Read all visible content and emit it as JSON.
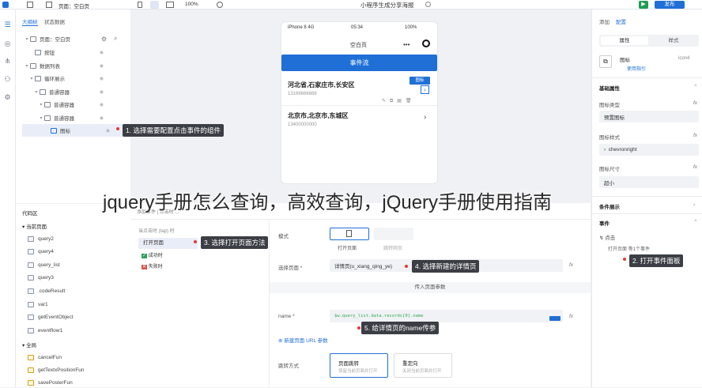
{
  "topbar": {
    "page_label": "页面：空白页",
    "zoom": "100%",
    "title": "小程序生成分享海报",
    "run_label": "",
    "publish_label": "发布"
  },
  "left": {
    "tabs": [
      "大纲树",
      "状态数据"
    ],
    "tree": [
      {
        "label": "页面：空白页",
        "indent": 0
      },
      {
        "label": "按钮",
        "indent": 1
      },
      {
        "label": "数据列表",
        "indent": 1
      },
      {
        "label": "循环展示",
        "indent": 2
      },
      {
        "label": "普通容器",
        "indent": 3
      },
      {
        "label": "普通容器",
        "indent": 4
      },
      {
        "label": "普通容器",
        "indent": 4
      },
      {
        "label": "图标",
        "indent": 5
      }
    ],
    "code_title": "代码区",
    "code_groups": [
      {
        "title": "当前页面",
        "items": [
          "query2",
          "query4",
          "query_list",
          "query3",
          ".codeResult",
          "var1",
          "getEventObject",
          "eventflow1"
        ]
      },
      {
        "title": "全局",
        "items": [
          "cancelFun",
          "getTextxPositionFun",
          "savePosterFun"
        ]
      }
    ]
  },
  "phone": {
    "status_left": "iPhone 8  4G",
    "time": "05:34",
    "battery": "100%",
    "page_title": "空白页",
    "button": "事件流",
    "addr1": "河北省,石家庄市,长安区",
    "phone1": "13166666666",
    "addr2": "北京市,北京市,东城区",
    "phone2": "13400000000",
    "chip": "图标"
  },
  "event": {
    "header": "添加事件 | 点击时 ...",
    "subheader": "当点击时 (tap) 时",
    "actions": [
      "打开页面",
      "成功时",
      "失败时"
    ],
    "mode_label": "模式",
    "mode_options": [
      "打开页面",
      "跳转网页"
    ],
    "select_label": "选择页面 *",
    "select_value": "详情页(u_xiang_qing_ye)",
    "params_title": "传入页面参数",
    "name_label": "name *",
    "name_value": "$w.query_list.data.records[0].name",
    "add_param": "新建页面 URL 参数",
    "jump_label": "跳转方式",
    "jump_opt1": "页面跳转",
    "jump_opt1_sub": "保留当前页面并打开",
    "jump_opt2": "重定向",
    "jump_opt2_sub": "关闭当前页面并打开"
  },
  "right": {
    "tabs": [
      "添加",
      "配置"
    ],
    "subtabs": [
      "属性",
      "样式"
    ],
    "component_name": "图标",
    "component_link": "使用指引",
    "component_id": "icon4",
    "basic": "基础属性",
    "icon_type_label": "图标类型",
    "icon_type_value": "预置图标",
    "icon_style_label": "图标样式",
    "icon_style_value": "chevronright",
    "icon_size_label": "图标尺寸",
    "icon_size_value": "超小",
    "cond": "条件展示",
    "events": "事件",
    "event_item": "点击",
    "event_sub": "打开页面 等1个事件"
  },
  "callouts": [
    "1. 选择需要配置点击事件的组件",
    "2. 打开事件面板",
    "3. 选择打开页面方法",
    "4. 选择新建的详情页",
    "5. 给详情页的name传参"
  ],
  "watermark": "jquery手册怎么查询，高效查询，jQuery手册使用指南"
}
